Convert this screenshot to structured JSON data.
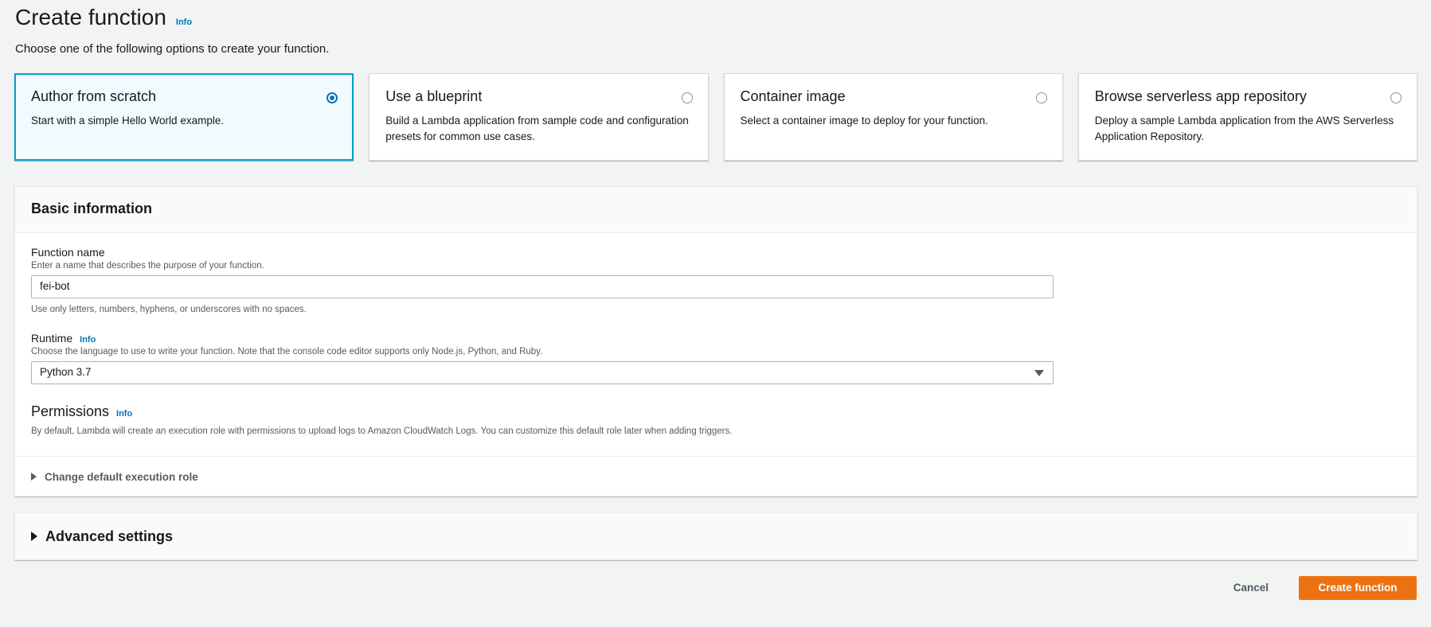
{
  "header": {
    "title": "Create function",
    "info": "Info",
    "subtitle": "Choose one of the following options to create your function."
  },
  "options": [
    {
      "title": "Author from scratch",
      "description": "Start with a simple Hello World example.",
      "selected": true
    },
    {
      "title": "Use a blueprint",
      "description": "Build a Lambda application from sample code and configuration presets for common use cases.",
      "selected": false
    },
    {
      "title": "Container image",
      "description": "Select a container image to deploy for your function.",
      "selected": false
    },
    {
      "title": "Browse serverless app repository",
      "description": "Deploy a sample Lambda application from the AWS Serverless Application Repository.",
      "selected": false
    }
  ],
  "basic": {
    "heading": "Basic information",
    "function_name": {
      "label": "Function name",
      "description": "Enter a name that describes the purpose of your function.",
      "value": "fei-bot",
      "constraint": "Use only letters, numbers, hyphens, or underscores with no spaces."
    },
    "runtime": {
      "label": "Runtime",
      "info": "Info",
      "description": "Choose the language to use to write your function. Note that the console code editor supports only Node.js, Python, and Ruby.",
      "value": "Python 3.7"
    },
    "permissions": {
      "title": "Permissions",
      "info": "Info",
      "description": "By default, Lambda will create an execution role with permissions to upload logs to Amazon CloudWatch Logs. You can customize this default role later when adding triggers.",
      "expander": "Change default execution role"
    }
  },
  "advanced": {
    "label": "Advanced settings"
  },
  "footer": {
    "cancel": "Cancel",
    "create": "Create function"
  },
  "colors": {
    "accent": "#0073bb",
    "primary_button": "#ec7211",
    "selected_border": "#00a1c9"
  }
}
